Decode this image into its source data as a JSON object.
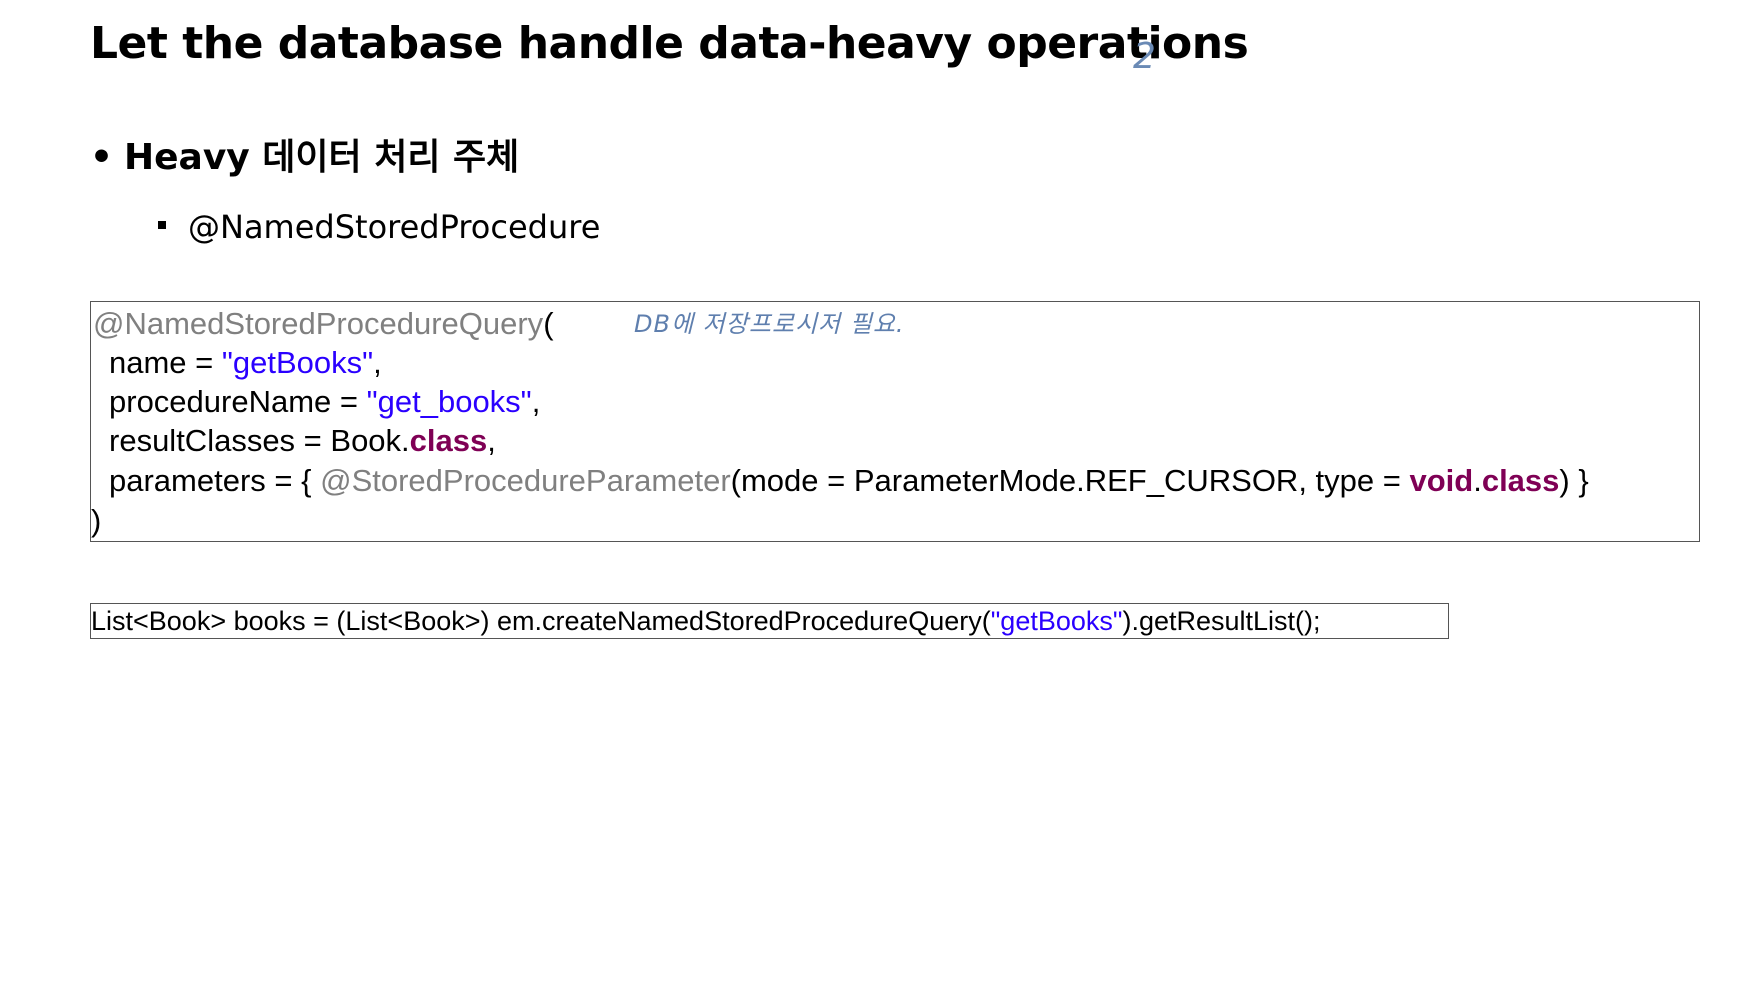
{
  "slide": {
    "title": "Let the database handle data-heavy operations",
    "handwritten_page_mark": "2",
    "bullet_1": "Heavy 데이터 처리 주체",
    "bullet_2": "@NamedStoredProcedure",
    "handwritten_note": "DB에 저장프로시저 필요."
  },
  "code_block_1": {
    "l1_annotation": "@NamedStoredProcedureQuery",
    "l1_paren": "(",
    "l2_prefix": "name = ",
    "l2_string": "\"getBooks\"",
    "l2_suffix": ",",
    "l3_prefix": "procedureName = ",
    "l3_string": "\"get_books\"",
    "l3_suffix": ",",
    "l4_prefix": "resultClasses = Book.",
    "l4_keyword": "class",
    "l4_suffix": ",",
    "l5_prefix": "parameters = { ",
    "l5_annotation": "@StoredProcedureParameter",
    "l5_middle": "(mode = ParameterMode.REF_CURSOR, type = ",
    "l5_kw1": "void",
    "l5_dot": ".",
    "l5_kw2": "class",
    "l5_suffix": ") }",
    "l6": ")"
  },
  "code_block_2": {
    "prefix": "List<Book> books = (List<Book>) em.createNamedStoredProcedureQuery(",
    "string": "\"getBooks\"",
    "suffix": ").getResultList();"
  },
  "colors": {
    "annotation": "#808080",
    "string": "#2a00ff",
    "keyword": "#7f0055",
    "handwriting": "#5f7fae"
  }
}
